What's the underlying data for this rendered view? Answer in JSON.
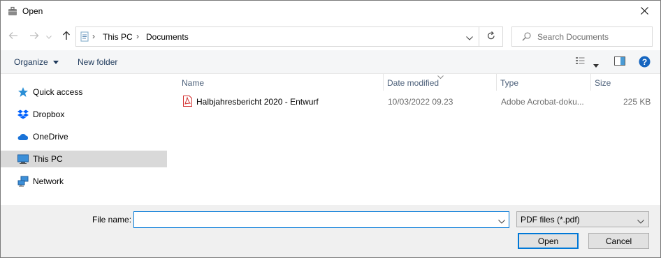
{
  "window": {
    "title": "Open",
    "close_icon": "close-icon",
    "app_icon": "briefcase-icon"
  },
  "nav": {
    "back_icon": "arrow-left-icon",
    "forward_icon": "arrow-right-icon",
    "up_icon": "arrow-up-icon"
  },
  "address": {
    "crumbs": [
      "This PC",
      "Documents"
    ],
    "refresh_icon": "refresh-icon"
  },
  "search": {
    "placeholder": "Search Documents",
    "value": ""
  },
  "toolbar": {
    "organize_label": "Organize",
    "new_folder_label": "New folder"
  },
  "sidebar": {
    "items": [
      {
        "label": "Quick access",
        "icon": "star-icon",
        "selected": false
      },
      {
        "label": "Dropbox",
        "icon": "dropbox-icon",
        "selected": false
      },
      {
        "label": "OneDrive",
        "icon": "cloud-icon",
        "selected": false
      },
      {
        "label": "This PC",
        "icon": "computer-icon",
        "selected": true
      },
      {
        "label": "Network",
        "icon": "network-icon",
        "selected": false
      }
    ]
  },
  "columns": {
    "name": "Name",
    "date": "Date modified",
    "type": "Type",
    "size": "Size"
  },
  "files": [
    {
      "name": "Halbjahresbericht 2020 - Entwurf",
      "date": "10/03/2022 09.23",
      "type": "Adobe Acrobat-doku...",
      "size": "225 KB",
      "icon": "pdf-icon"
    }
  ],
  "footer": {
    "file_name_label": "File name:",
    "file_name_value": "",
    "filter_value": "PDF files (*.pdf)",
    "open_label": "Open",
    "cancel_label": "Cancel"
  },
  "colors": {
    "accent": "#0078d7",
    "selected_bg": "#d9d9d9",
    "pdf_red": "#d32f2f",
    "help_blue": "#1565c0"
  }
}
